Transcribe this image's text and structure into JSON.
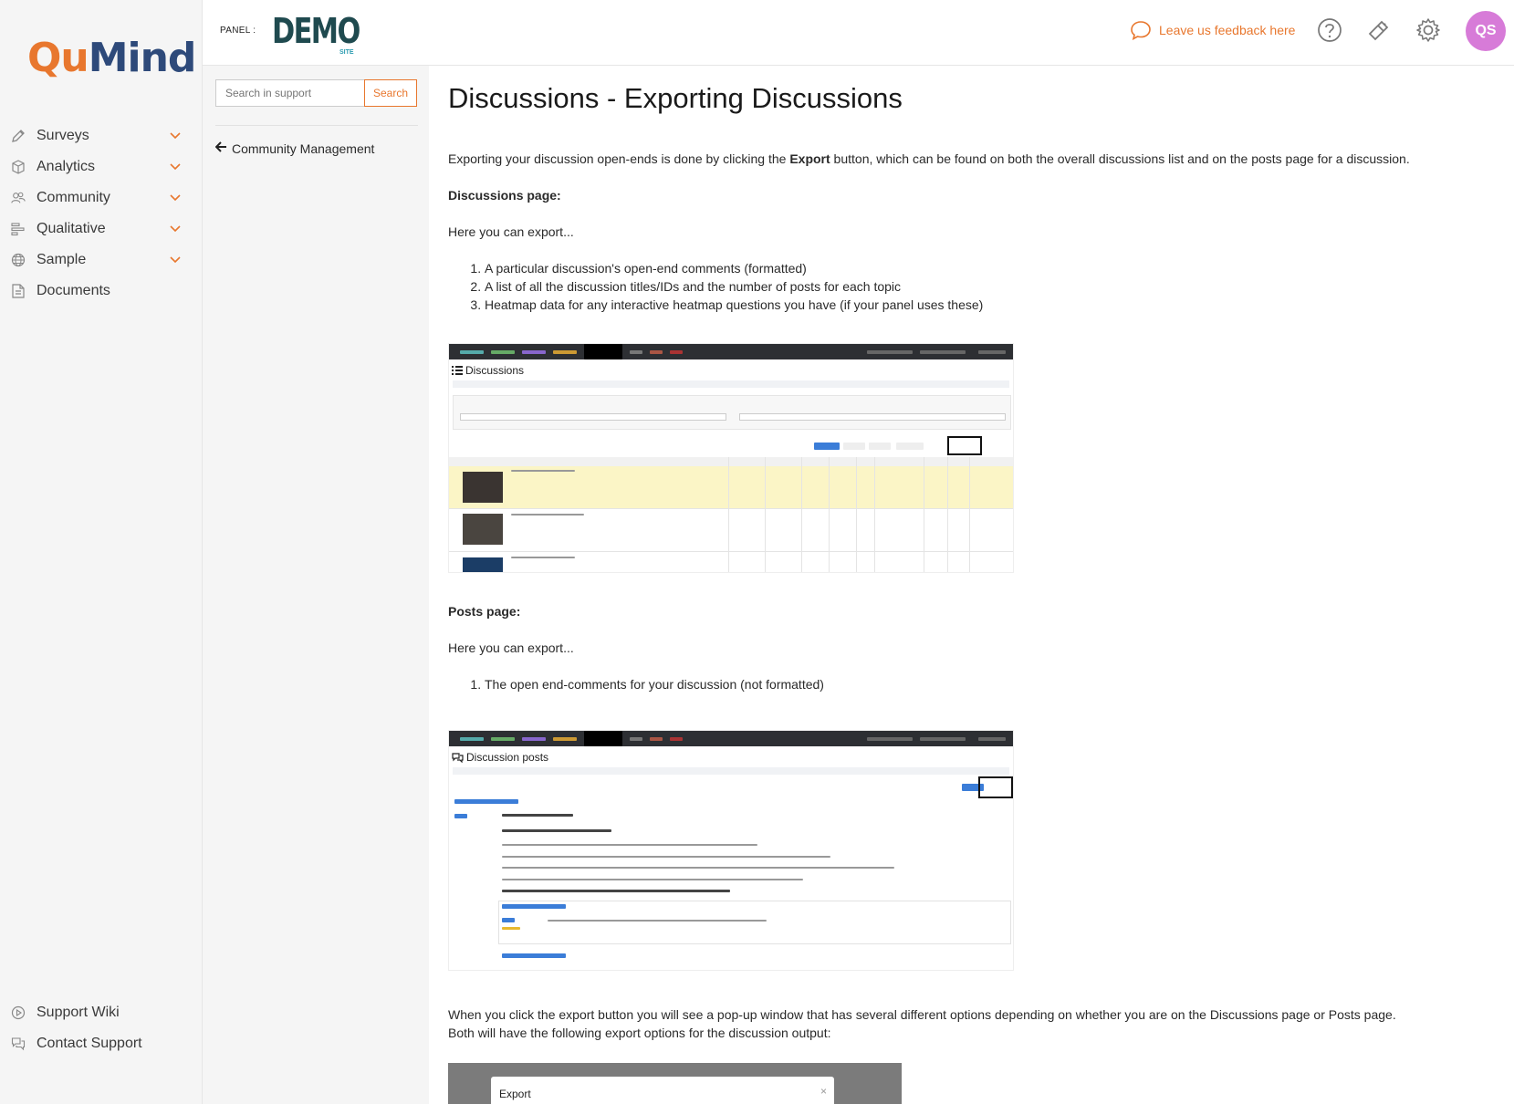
{
  "brand": {
    "qu": "Qu",
    "mind": "Mind"
  },
  "sidebar": {
    "items": [
      {
        "label": "Surveys",
        "icon": "pencil-icon",
        "expandable": true
      },
      {
        "label": "Analytics",
        "icon": "cube-icon",
        "expandable": true
      },
      {
        "label": "Community",
        "icon": "users-icon",
        "expandable": true
      },
      {
        "label": "Qualitative",
        "icon": "bars-icon",
        "expandable": true
      },
      {
        "label": "Sample",
        "icon": "globe-icon",
        "expandable": true
      },
      {
        "label": "Documents",
        "icon": "document-icon",
        "expandable": false
      }
    ],
    "bottom_items": [
      {
        "label": "Support Wiki",
        "icon": "play-circle-icon"
      },
      {
        "label": "Contact Support",
        "icon": "chat-icon"
      }
    ]
  },
  "header": {
    "panel_label": "PANEL :",
    "panel_logo": "DEMO",
    "panel_logo_sub": "SITE",
    "feedback_label": "Leave us feedback here",
    "avatar_initials": "QS",
    "accent_color": "#e8772e",
    "avatar_color": "#d77bd8"
  },
  "support": {
    "search_placeholder": "Search in support",
    "search_button": "Search",
    "back_link": "Community Management"
  },
  "article": {
    "title": "Discussions - Exporting Discussions",
    "intro_before": "Exporting your discussion open-ends is done by clicking the ",
    "intro_bold": "Export",
    "intro_after": " button, which can be found on both the overall discussions list and on the posts page for a discussion.",
    "discussions_heading": "Discussions page:",
    "discussions_lead": "Here you can export...",
    "discussions_list": [
      "A particular discussion's open-end comments (formatted)",
      "A list of all the discussion titles/IDs and the number of posts for each topic",
      "Heatmap data for any interactive heatmap questions you have (if your panel uses these)"
    ],
    "shot1_title": "Discussions",
    "posts_heading": "Posts page:",
    "posts_lead": "Here you can export...",
    "posts_list": [
      "The open end-comments for your discussion (not formatted)"
    ],
    "shot2_title": "Discussion posts",
    "closing_line1": "When you click the export button you will see a pop-up window that has several different options depending on whether you are on the Discussions page or Posts page.",
    "closing_line2": "Both will have the following export options for the discussion output:",
    "export_modal_title": "Export",
    "export_modal_close": "×"
  }
}
